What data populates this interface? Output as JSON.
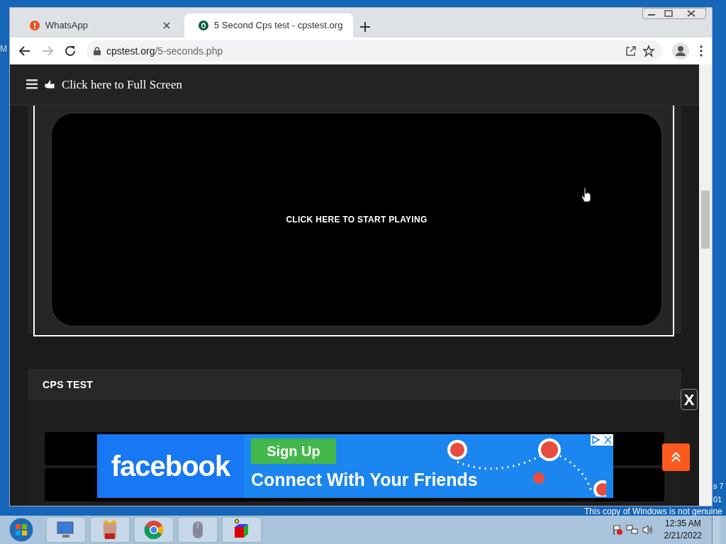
{
  "desktop": {
    "edge_texts": [
      "M",
      "s 7",
      "01"
    ],
    "watermark_note": "This copy of Windows is not genuine"
  },
  "browser": {
    "tabs": [
      {
        "title": "WhatsApp",
        "selected": false,
        "kind": "alert"
      },
      {
        "title": "5 Second Cps test - cpstest.org",
        "selected": true,
        "kind": "site"
      }
    ],
    "url_host": "cpstest.org",
    "url_path": "/5-seconds.php"
  },
  "page": {
    "header": {
      "label": "Click here to Full Screen"
    },
    "game": {
      "prompt": "CLICK HERE TO START PLAYING"
    },
    "card": {
      "title": "CPS TEST"
    },
    "ad": {
      "brand": "facebook",
      "cta": "Sign Up",
      "tagline": "Connect With Your Friends"
    },
    "close_label": "X"
  },
  "taskbar": {
    "time": "12:35 AM",
    "date": "2/21/2022"
  }
}
